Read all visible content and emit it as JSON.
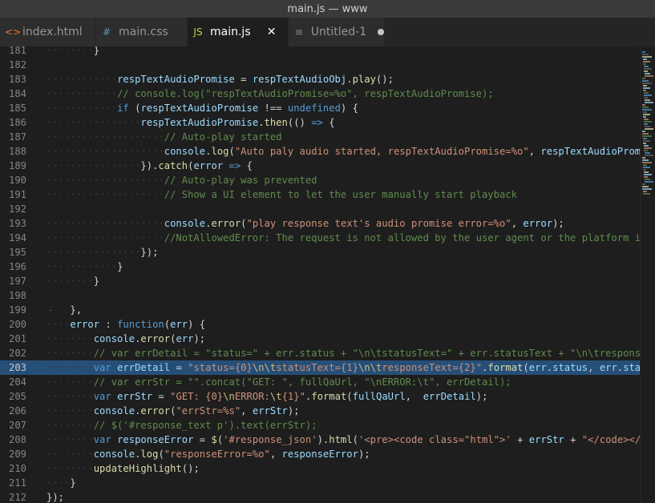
{
  "window": {
    "title": "main.js — www"
  },
  "tabs": [
    {
      "label": "index.html",
      "icon": "<>",
      "icon_color": "#e37933",
      "active": false,
      "dirty": false,
      "width": 120
    },
    {
      "label": "main.css",
      "icon": "#",
      "icon_color": "#519aba",
      "active": false,
      "dirty": false,
      "width": 114
    },
    {
      "label": "main.js",
      "icon": "JS",
      "icon_color": "#cbcb41",
      "active": true,
      "dirty": false,
      "width": 126,
      "close": "✕"
    },
    {
      "label": "Untitled-1",
      "icon": "≡",
      "icon_color": "#8d8d8d",
      "active": false,
      "dirty": true,
      "width": 120
    }
  ],
  "editor": {
    "selected_line": 203,
    "lines": [
      {
        "n": "181",
        "tokens": [
          [
            "ws",
            "········"
          ],
          [
            "pn",
            "}"
          ]
        ]
      },
      {
        "n": "182",
        "tokens": []
      },
      {
        "n": "183",
        "tokens": [
          [
            "ws",
            "············"
          ],
          [
            "vr",
            "respTextAudioPromise"
          ],
          [
            "pn",
            " = "
          ],
          [
            "vr",
            "respTextAudioObj"
          ],
          [
            "pn",
            "."
          ],
          [
            "fn",
            "play"
          ],
          [
            "pn",
            "();"
          ]
        ]
      },
      {
        "n": "184",
        "tokens": [
          [
            "ws",
            "············"
          ],
          [
            "cm",
            "// console.log(\"respTextAudioPromise=%o\", respTextAudioPromise);"
          ]
        ]
      },
      {
        "n": "185",
        "tokens": [
          [
            "ws",
            "············"
          ],
          [
            "kw",
            "if"
          ],
          [
            "pn",
            " ("
          ],
          [
            "vr",
            "respTextAudioPromise"
          ],
          [
            "pn",
            " !== "
          ],
          [
            "kw",
            "undefined"
          ],
          [
            "pn",
            ") {"
          ]
        ]
      },
      {
        "n": "186",
        "tokens": [
          [
            "ws",
            "················"
          ],
          [
            "vr",
            "respTextAudioPromise"
          ],
          [
            "pn",
            "."
          ],
          [
            "fn",
            "then"
          ],
          [
            "pn",
            "(() "
          ],
          [
            "kw",
            "=>"
          ],
          [
            "pn",
            " {"
          ]
        ]
      },
      {
        "n": "187",
        "tokens": [
          [
            "ws",
            "····················"
          ],
          [
            "cm",
            "// Auto-play started"
          ]
        ]
      },
      {
        "n": "188",
        "tokens": [
          [
            "ws",
            "····················"
          ],
          [
            "vr",
            "console"
          ],
          [
            "pn",
            "."
          ],
          [
            "fn",
            "log"
          ],
          [
            "pn",
            "("
          ],
          [
            "st",
            "\"Auto paly audio started, respTextAudioPromise=%o\""
          ],
          [
            "pn",
            ", "
          ],
          [
            "vr",
            "respTextAudioPromise"
          ],
          [
            "pn",
            ");"
          ]
        ]
      },
      {
        "n": "189",
        "tokens": [
          [
            "ws",
            "················"
          ],
          [
            "pn",
            "})."
          ],
          [
            "fn",
            "catch"
          ],
          [
            "pn",
            "("
          ],
          [
            "vr",
            "error"
          ],
          [
            "pn",
            " "
          ],
          [
            "kw",
            "=>"
          ],
          [
            "pn",
            " {"
          ]
        ]
      },
      {
        "n": "190",
        "tokens": [
          [
            "ws",
            "····················"
          ],
          [
            "cm",
            "// Auto-play was prevented"
          ]
        ]
      },
      {
        "n": "191",
        "tokens": [
          [
            "ws",
            "····················"
          ],
          [
            "cm",
            "// Show a UI element to let the user manually start playback"
          ]
        ]
      },
      {
        "n": "192",
        "tokens": []
      },
      {
        "n": "193",
        "tokens": [
          [
            "ws",
            "····················"
          ],
          [
            "vr",
            "console"
          ],
          [
            "pn",
            "."
          ],
          [
            "fn",
            "error"
          ],
          [
            "pn",
            "("
          ],
          [
            "st",
            "\"play response text's audio promise error=%o\""
          ],
          [
            "pn",
            ", "
          ],
          [
            "vr",
            "error"
          ],
          [
            "pn",
            ");"
          ]
        ]
      },
      {
        "n": "194",
        "tokens": [
          [
            "ws",
            "····················"
          ],
          [
            "cm",
            "//NotAllowedError: The request is not allowed by the user agent or the platform in the current context"
          ]
        ]
      },
      {
        "n": "195",
        "tokens": [
          [
            "ws",
            "················"
          ],
          [
            "pn",
            "});"
          ]
        ]
      },
      {
        "n": "196",
        "tokens": [
          [
            "ws",
            "············"
          ],
          [
            "pn",
            "}"
          ]
        ]
      },
      {
        "n": "197",
        "tokens": [
          [
            "ws",
            "········"
          ],
          [
            "pn",
            "}"
          ]
        ]
      },
      {
        "n": "198",
        "tokens": []
      },
      {
        "n": "199",
        "tokens": [
          [
            "ws",
            "→   "
          ],
          [
            "pn",
            "},"
          ]
        ]
      },
      {
        "n": "200",
        "tokens": [
          [
            "ws",
            "····"
          ],
          [
            "vr",
            "error"
          ],
          [
            "pn",
            " : "
          ],
          [
            "kw",
            "function"
          ],
          [
            "pn",
            "("
          ],
          [
            "vr",
            "err"
          ],
          [
            "pn",
            ") {"
          ]
        ]
      },
      {
        "n": "201",
        "tokens": [
          [
            "ws",
            "········"
          ],
          [
            "vr",
            "console"
          ],
          [
            "pn",
            "."
          ],
          [
            "fn",
            "error"
          ],
          [
            "pn",
            "("
          ],
          [
            "vr",
            "err"
          ],
          [
            "pn",
            ");"
          ]
        ]
      },
      {
        "n": "202",
        "tokens": [
          [
            "ws",
            "········"
          ],
          [
            "cm",
            "// var errDetail = \"status=\" + err.status + \"\\n\\tstatusText=\" + err.statusText + \"\\n\\tresponseText=\" + err.responseText;"
          ]
        ]
      },
      {
        "n": "203",
        "tokens": [
          [
            "ws",
            "········"
          ],
          [
            "kw",
            "var"
          ],
          [
            "pn",
            " "
          ],
          [
            "vr",
            "errDetail"
          ],
          [
            "pn",
            " = "
          ],
          [
            "st",
            "\"status={0}"
          ],
          [
            "es",
            "\\n\\t"
          ],
          [
            "st",
            "statusText={1}"
          ],
          [
            "es",
            "\\n\\t"
          ],
          [
            "st",
            "responseText={2}\""
          ],
          [
            "pn",
            "."
          ],
          [
            "fn",
            "format"
          ],
          [
            "pn",
            "("
          ],
          [
            "vr",
            "err"
          ],
          [
            "pn",
            "."
          ],
          [
            "vr",
            "status"
          ],
          [
            "pn",
            ", "
          ],
          [
            "vr",
            "err"
          ],
          [
            "pn",
            "."
          ],
          [
            "vr",
            "statusText"
          ],
          [
            "pn",
            ", "
          ],
          [
            "vr",
            "err"
          ],
          [
            "pn",
            "."
          ],
          [
            "vr",
            "responseText"
          ],
          [
            "pn",
            ");"
          ]
        ]
      },
      {
        "n": "204",
        "tokens": [
          [
            "ws",
            "········"
          ],
          [
            "cm",
            "// var errStr = \"\".concat(\"GET: \", fullQaUrl, \"\\nERROR:\\t\", errDetail);"
          ]
        ]
      },
      {
        "n": "205",
        "tokens": [
          [
            "ws",
            "········"
          ],
          [
            "kw",
            "var"
          ],
          [
            "pn",
            " "
          ],
          [
            "vr",
            "errStr"
          ],
          [
            "pn",
            " = "
          ],
          [
            "st",
            "\"GET: {0}"
          ],
          [
            "es",
            "\\n"
          ],
          [
            "st",
            "ERROR:"
          ],
          [
            "es",
            "\\t"
          ],
          [
            "st",
            "{1}\""
          ],
          [
            "pn",
            "."
          ],
          [
            "fn",
            "format"
          ],
          [
            "pn",
            "("
          ],
          [
            "vr",
            "fullQaUrl"
          ],
          [
            "pn",
            ",  "
          ],
          [
            "vr",
            "errDetail"
          ],
          [
            "pn",
            ");"
          ]
        ]
      },
      {
        "n": "206",
        "tokens": [
          [
            "ws",
            "········"
          ],
          [
            "vr",
            "console"
          ],
          [
            "pn",
            "."
          ],
          [
            "fn",
            "error"
          ],
          [
            "pn",
            "("
          ],
          [
            "st",
            "\"errStr=%s\""
          ],
          [
            "pn",
            ", "
          ],
          [
            "vr",
            "errStr"
          ],
          [
            "pn",
            ");"
          ]
        ]
      },
      {
        "n": "207",
        "tokens": [
          [
            "ws",
            "········"
          ],
          [
            "cm",
            "// $('#response_text p').text(errStr);"
          ]
        ]
      },
      {
        "n": "208",
        "tokens": [
          [
            "ws",
            "········"
          ],
          [
            "kw",
            "var"
          ],
          [
            "pn",
            " "
          ],
          [
            "vr",
            "responseError"
          ],
          [
            "pn",
            " = "
          ],
          [
            "fn",
            "$"
          ],
          [
            "pn",
            "("
          ],
          [
            "st",
            "'#response_json'"
          ],
          [
            "pn",
            ")."
          ],
          [
            "fn",
            "html"
          ],
          [
            "pn",
            "("
          ],
          [
            "st",
            "'<pre><code class=\"html\">'"
          ],
          [
            "pn",
            " + "
          ],
          [
            "vr",
            "errStr"
          ],
          [
            "pn",
            " + "
          ],
          [
            "st",
            "\"</code></pre>\""
          ],
          [
            "pn",
            ");"
          ]
        ]
      },
      {
        "n": "209",
        "tokens": [
          [
            "ws",
            "········"
          ],
          [
            "vr",
            "console"
          ],
          [
            "pn",
            "."
          ],
          [
            "fn",
            "log"
          ],
          [
            "pn",
            "("
          ],
          [
            "st",
            "\"responseError=%o\""
          ],
          [
            "pn",
            ", "
          ],
          [
            "vr",
            "responseError"
          ],
          [
            "pn",
            ");"
          ]
        ]
      },
      {
        "n": "210",
        "tokens": [
          [
            "ws",
            "········"
          ],
          [
            "fn",
            "updateHighlight"
          ],
          [
            "pn",
            "();"
          ]
        ]
      },
      {
        "n": "211",
        "tokens": [
          [
            "ws",
            "····"
          ],
          [
            "pn",
            "}"
          ]
        ]
      },
      {
        "n": "212",
        "tokens": [
          [
            "pn",
            "});"
          ]
        ]
      },
      {
        "n": "213",
        "tokens": []
      }
    ]
  },
  "minimap": {
    "colors": [
      "#569cd6",
      "#608b4e",
      "#ce9178",
      "#9cdcfe",
      "#dcdcaa",
      "#6a6a6a"
    ]
  }
}
